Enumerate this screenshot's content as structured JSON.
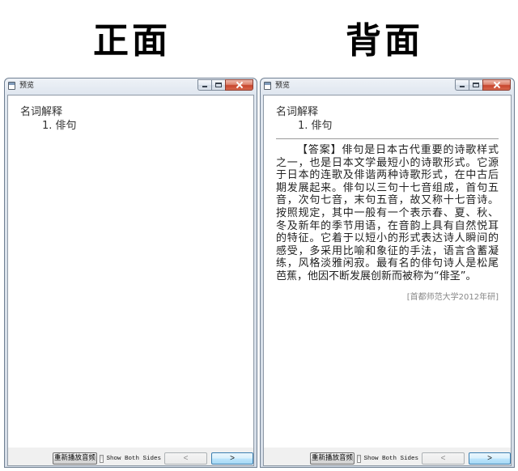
{
  "headings": {
    "front": "正面",
    "back": "背面"
  },
  "front_window": {
    "title": "预览",
    "section": "名词解释",
    "question": "1. 俳句",
    "bottom_bar": {
      "replay_label": "重新播放音频",
      "show_both_sides_label": "Show Both Sides",
      "show_both_sides_checked": false,
      "prev_label": "<",
      "next_label": ">"
    }
  },
  "back_window": {
    "title": "预览",
    "section": "名词解释",
    "question": "1. 俳句",
    "answer_lines": [
      "【答案】俳句是日本古代重要的诗歌样式",
      "之一，也是日本文学最短小的诗歌形式。它源",
      "于日本的连歌及俳谐两种诗歌形式，在中古后",
      "期发展起来。俳句以三句十七音组成，首句五",
      "音，次句七音，末句五音，故又称十七音诗。",
      "按照规定，其中一般有一个表示春、夏、秋、",
      "冬及新年的季节用语，在音韵上具有自然悦耳",
      "的特征。它着于以短小的形式表达诗人瞬间的",
      "感受，多采用比喻和象征的手法，语言含蓄凝",
      "练，风格淡雅闲寂。最有名的俳句诗人是松尾",
      "芭蕉，他因不断发展创新而被称为“俳圣”。"
    ],
    "source": "[首都师范大学2012年研]",
    "bottom_bar": {
      "replay_label": "重新播放音频",
      "show_both_sides_label": "Show Both Sides",
      "show_both_sides_checked": false,
      "prev_label": "<",
      "next_label": ">"
    }
  },
  "icons": {
    "title": "app-window-icon",
    "minimize": "minimize-icon",
    "maximize": "maximize-icon",
    "close": "close-icon"
  },
  "colors": {
    "close_button": "#c7452d",
    "default_button_border": "#3c7fb1",
    "source_text": "#888888"
  }
}
